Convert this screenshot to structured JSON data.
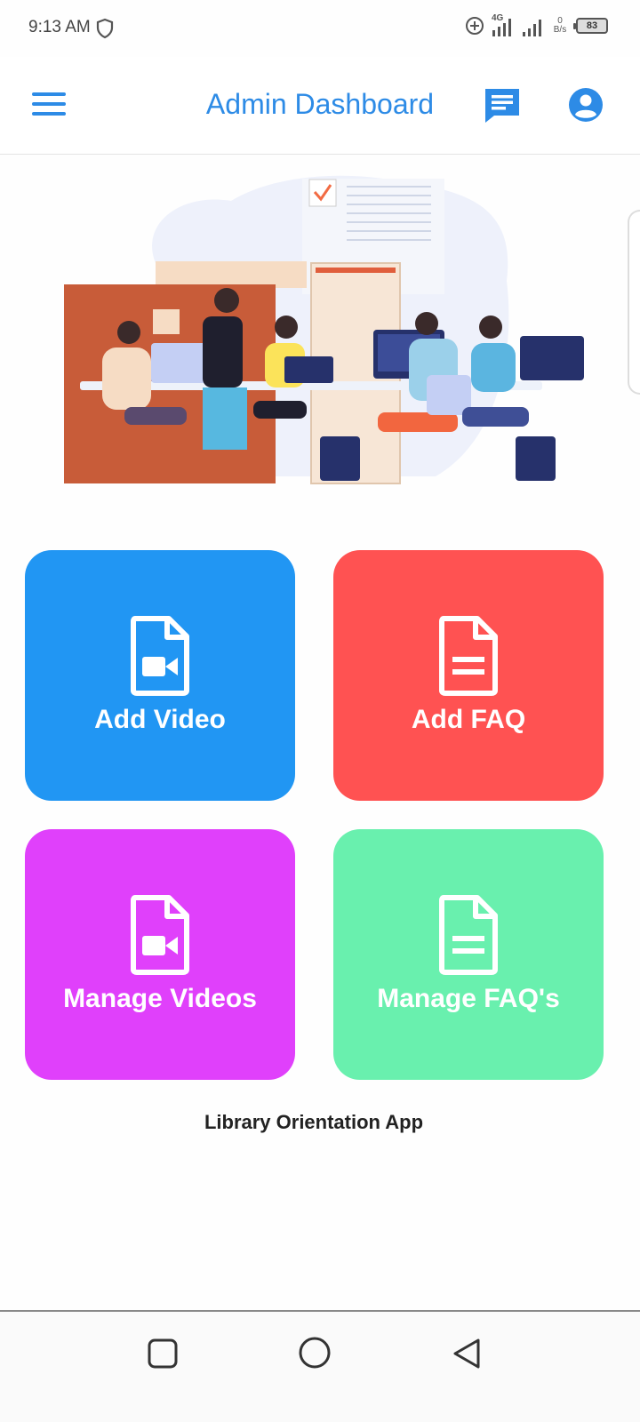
{
  "status_bar": {
    "time": "9:13 AM",
    "network_type": "4G",
    "speed_value": "0",
    "speed_unit": "B/s",
    "battery": "83"
  },
  "app_bar": {
    "title": "Admin Dashboard",
    "menu_icon": "hamburger-menu-icon",
    "message_icon": "chat-message-icon",
    "profile_icon": "account-circle-icon"
  },
  "tiles": [
    {
      "label": "Add Video",
      "icon": "video-file-icon",
      "color": "#2196f3"
    },
    {
      "label": "Add FAQ",
      "icon": "document-file-icon",
      "color": "#ff5252"
    },
    {
      "label": "Manage Videos",
      "icon": "video-file-icon",
      "color": "#e040fb"
    },
    {
      "label": "Manage FAQ's",
      "icon": "document-file-icon",
      "color": "#69f0ae"
    }
  ],
  "footer": {
    "text": "Library Orientation App"
  },
  "colors": {
    "accent": "#2d8be6"
  },
  "nav": {
    "recent_icon": "square-recent-apps-icon",
    "home_icon": "circle-home-icon",
    "back_icon": "triangle-back-icon"
  }
}
